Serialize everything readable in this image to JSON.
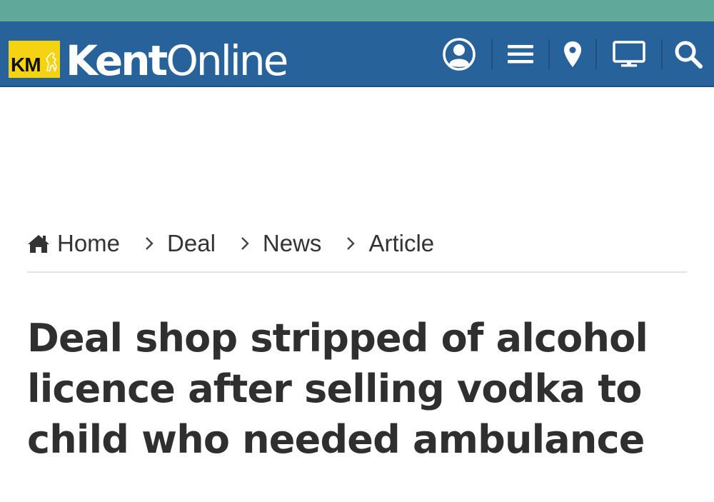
{
  "header": {
    "logo_badge": "KM",
    "brand_bold": "Kent",
    "brand_light": "Online",
    "icons": [
      "user-icon",
      "menu-icon",
      "location-pin-icon",
      "tv-icon",
      "search-icon"
    ]
  },
  "breadcrumb": {
    "items": [
      {
        "label": "Home",
        "icon": "home-icon"
      },
      {
        "label": "Deal"
      },
      {
        "label": "News"
      },
      {
        "label": "Article"
      }
    ]
  },
  "article": {
    "headline": "Deal shop stripped of alcohol licence after selling vodka to child who needed ambulance"
  },
  "colors": {
    "top_strip": "#5fa89a",
    "header_bg": "#28629a",
    "logo_yellow": "#f5d313",
    "text": "#2f2f2f"
  }
}
